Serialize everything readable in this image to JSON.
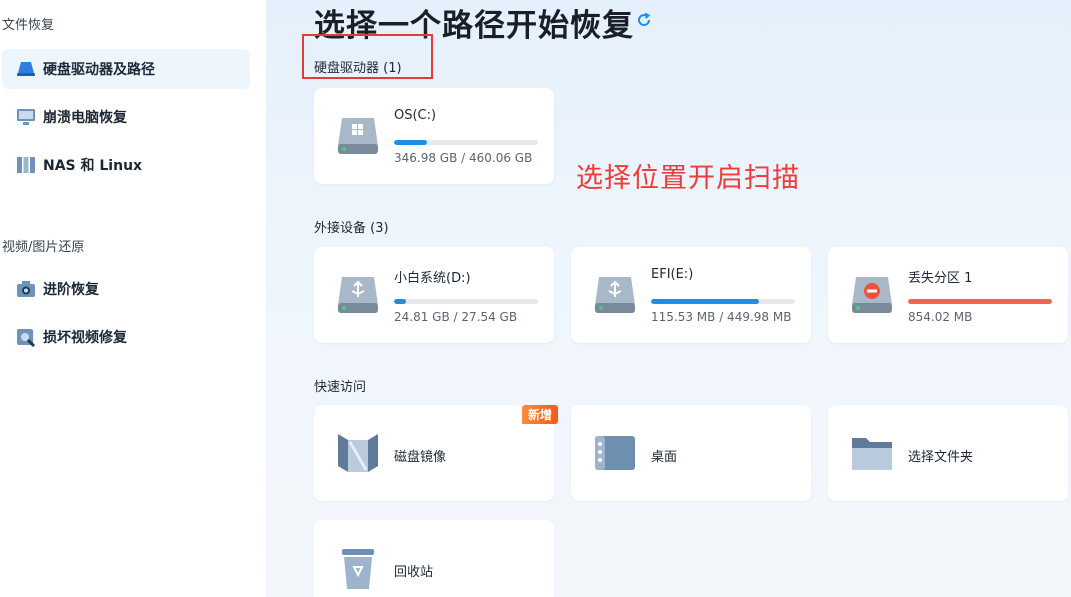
{
  "sidebar": {
    "section_file": "文件恢复",
    "section_media": "视频/图片还原",
    "items": [
      {
        "label": "硬盘驱动器及路径",
        "icon": "drive-icon",
        "active": true
      },
      {
        "label": "崩溃电脑恢复",
        "icon": "monitor-icon",
        "active": false
      },
      {
        "label": "NAS 和 Linux",
        "icon": "nas-icon",
        "active": false
      },
      {
        "label": "进阶恢复",
        "icon": "camera-icon",
        "active": false
      },
      {
        "label": "损坏视频修复",
        "icon": "video-repair-icon",
        "active": false
      }
    ]
  },
  "main": {
    "title": "选择一个路径开始恢复",
    "annotation": "选择位置开启扫描",
    "hard_drives": {
      "label": "硬盘驱动器 (1)",
      "items": [
        {
          "name": "OS(C:)",
          "size": "346.98 GB / 460.06 GB",
          "usage": 0.23,
          "color": "#1e8fe8",
          "icon": "windows-drive-icon"
        }
      ]
    },
    "external": {
      "label": "外接设备 (3)",
      "items": [
        {
          "name": "小白系统(D:)",
          "size": "24.81 GB / 27.54 GB",
          "usage": 0.08,
          "color": "#1e8fe8",
          "icon": "usb-drive-icon"
        },
        {
          "name": "EFI(E:)",
          "size": "115.53 MB / 449.98 MB",
          "usage": 0.75,
          "color": "#1e8fe8",
          "icon": "usb-drive-icon"
        },
        {
          "name": "丢失分区 1",
          "size": "854.02 MB",
          "usage": 1.0,
          "color": "#f06452",
          "icon": "lost-partition-icon"
        }
      ]
    },
    "quick": {
      "label": "快速访问",
      "items": [
        {
          "name": "磁盘镜像",
          "badge": "新增",
          "icon": "disk-image-icon"
        },
        {
          "name": "桌面",
          "icon": "desktop-icon"
        },
        {
          "name": "选择文件夹",
          "icon": "folder-icon"
        },
        {
          "name": "回收站",
          "icon": "recycle-bin-icon"
        }
      ]
    }
  }
}
